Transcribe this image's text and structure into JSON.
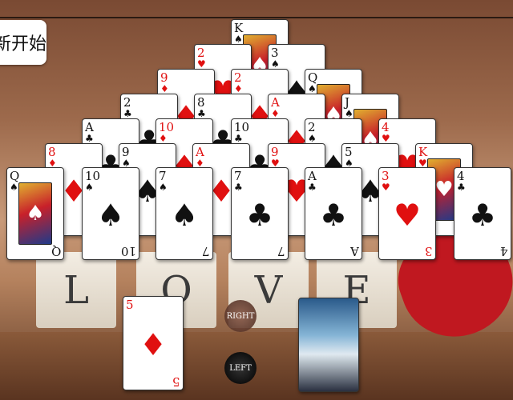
{
  "restart_label": "新开始",
  "right_label": "RIGHT",
  "left_label": "LEFT",
  "cubes": [
    "L",
    "O",
    "V",
    "E"
  ],
  "cards": [
    {
      "rank": "K",
      "suit": "♠",
      "color": "black",
      "face": true
    },
    {
      "rank": "2",
      "suit": "♥",
      "color": "red",
      "face": false
    },
    {
      "rank": "3",
      "suit": "♠",
      "color": "black",
      "face": false
    },
    {
      "rank": "9",
      "suit": "♦",
      "color": "red",
      "face": false
    },
    {
      "rank": "2",
      "suit": "♦",
      "color": "red",
      "face": false
    },
    {
      "rank": "Q",
      "suit": "♠",
      "color": "black",
      "face": true
    },
    {
      "rank": "2",
      "suit": "♣",
      "color": "black",
      "face": false
    },
    {
      "rank": "8",
      "suit": "♣",
      "color": "black",
      "face": false
    },
    {
      "rank": "A",
      "suit": "♦",
      "color": "red",
      "face": false
    },
    {
      "rank": "J",
      "suit": "♠",
      "color": "black",
      "face": true
    },
    {
      "rank": "A",
      "suit": "♣",
      "color": "black",
      "face": false
    },
    {
      "rank": "10",
      "suit": "♦",
      "color": "red",
      "face": false
    },
    {
      "rank": "10",
      "suit": "♣",
      "color": "black",
      "face": false
    },
    {
      "rank": "2",
      "suit": "♠",
      "color": "black",
      "face": false
    },
    {
      "rank": "4",
      "suit": "♥",
      "color": "red",
      "face": false
    },
    {
      "rank": "8",
      "suit": "♦",
      "color": "red",
      "face": false
    },
    {
      "rank": "9",
      "suit": "♠",
      "color": "black",
      "face": false
    },
    {
      "rank": "A",
      "suit": "♦",
      "color": "red",
      "face": false
    },
    {
      "rank": "9",
      "suit": "♥",
      "color": "red",
      "face": false
    },
    {
      "rank": "5",
      "suit": "♠",
      "color": "black",
      "face": false
    },
    {
      "rank": "K",
      "suit": "♥",
      "color": "red",
      "face": true
    },
    {
      "rank": "Q",
      "suit": "♠",
      "color": "black",
      "face": true
    },
    {
      "rank": "10",
      "suit": "♠",
      "color": "black",
      "face": false
    },
    {
      "rank": "7",
      "suit": "♠",
      "color": "black",
      "face": false
    },
    {
      "rank": "7",
      "suit": "♣",
      "color": "black",
      "face": false
    },
    {
      "rank": "A",
      "suit": "♣",
      "color": "black",
      "face": false
    },
    {
      "rank": "3",
      "suit": "♥",
      "color": "red",
      "face": false
    },
    {
      "rank": "4",
      "suit": "♣",
      "color": "black",
      "face": false
    }
  ],
  "waste_card": {
    "rank": "5",
    "suit": "♦",
    "color": "red"
  }
}
